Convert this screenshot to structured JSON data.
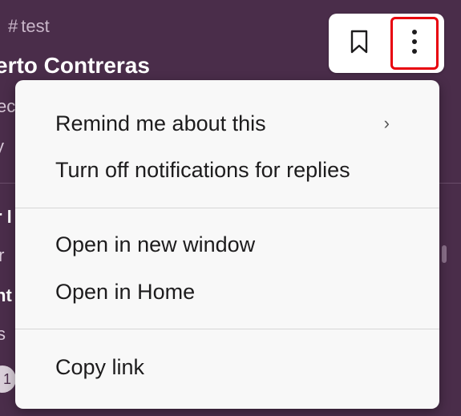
{
  "background": {
    "channel_name": "test",
    "author_fragment": "erto Contreras",
    "fragments": [
      "ec",
      "y",
      "r l",
      "tr",
      "nt",
      "s"
    ],
    "avatar_badge": "1"
  },
  "toolbar": {
    "bookmark_icon": "bookmark-icon",
    "more_icon": "vertical-ellipsis-icon",
    "highlight_color": "#e8000d"
  },
  "menu": {
    "items": [
      {
        "label": "Remind me about this",
        "has_submenu": true
      },
      {
        "label": "Turn off notifications for replies"
      },
      {
        "label": "Open in new window"
      },
      {
        "label": "Open in Home"
      },
      {
        "label": "Copy link"
      }
    ],
    "submenu_glyph": "›"
  }
}
